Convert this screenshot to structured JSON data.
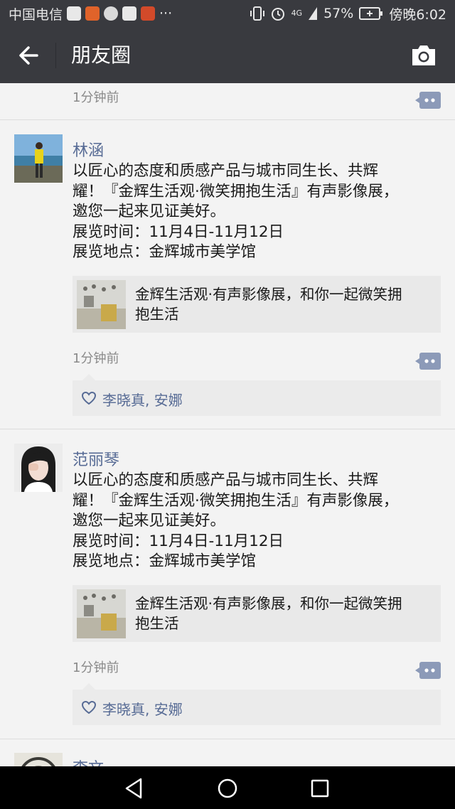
{
  "status_bar": {
    "carrier": "中国电信",
    "network": "4G",
    "battery": "57%",
    "time": "傍晚6:02",
    "more": "···"
  },
  "header": {
    "title": "朋友圈"
  },
  "top_partial": {
    "time": "1分钟前"
  },
  "posts": [
    {
      "name": "林涵",
      "lines": [
        "以匠心的态度和质感产品与城市同生长、共辉",
        "耀！『金辉生活观·微笑拥抱生活』有声影像展，",
        "邀您一起来见证美好。",
        "展览时间：11月4日-11月12日",
        "展览地点：金辉城市美学馆"
      ],
      "link_lines": [
        "金辉生活观·有声影像展，和你一起微笑拥",
        "抱生活"
      ],
      "time": "1分钟前",
      "likes": "李晓真, 安娜"
    },
    {
      "name": "范丽琴",
      "lines": [
        "以匠心的态度和质感产品与城市同生长、共辉",
        "耀！『金辉生活观·微笑拥抱生活』有声影像展，",
        "邀您一起来见证美好。",
        "展览时间：11月4日-11月12日",
        "展览地点：金辉城市美学馆"
      ],
      "link_lines": [
        "金辉生活观·有声影像展，和你一起微笑拥",
        "抱生活"
      ],
      "time": "1分钟前",
      "likes": "李晓真, 安娜"
    }
  ],
  "bottom_partial": {
    "name": "李文"
  },
  "colors": {
    "bar": "#393a3f",
    "name": "#576b95",
    "bg": "#f3f3f3"
  }
}
